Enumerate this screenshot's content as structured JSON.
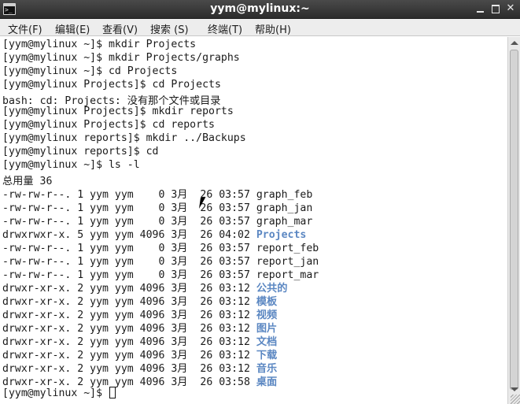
{
  "window": {
    "title": "yym@mylinux:~",
    "close_glyph": "✕"
  },
  "menu": [
    "文件(F)",
    "编辑(E)",
    "查看(V)",
    "搜索 (S)",
    "终端(T)",
    "帮助(H)"
  ],
  "terminal_lines": [
    {
      "text": "[yym@mylinux ~]$ mkdir Projects"
    },
    {
      "text": "[yym@mylinux ~]$ mkdir Projects/graphs"
    },
    {
      "text": "[yym@mylinux ~]$ cd Projects"
    },
    {
      "text": "[yym@mylinux Projects]$ cd Projects"
    },
    {
      "text": "bash: cd: Projects: 没有那个文件或目录"
    },
    {
      "text": "[yym@mylinux Projects]$ mkdir reports"
    },
    {
      "text": "[yym@mylinux Projects]$ cd reports"
    },
    {
      "text": "[yym@mylinux reports]$ mkdir ../Backups"
    },
    {
      "text": "[yym@mylinux reports]$ cd"
    },
    {
      "text": "[yym@mylinux ~]$ ls -l"
    },
    {
      "text": "总用量 36"
    },
    {
      "prefix": "-rw-rw-r--. 1 yym yym    0 3月  26 03:57 ",
      "name": "graph_feb",
      "dir": false
    },
    {
      "prefix": "-rw-rw-r--. 1 yym yym    0 3月  26 03:57 ",
      "name": "graph_jan",
      "dir": false
    },
    {
      "prefix": "-rw-rw-r--. 1 yym yym    0 3月  26 03:57 ",
      "name": "graph_mar",
      "dir": false
    },
    {
      "prefix": "drwxrwxr-x. 5 yym yym 4096 3月  26 04:02 ",
      "name": "Projects",
      "dir": true
    },
    {
      "prefix": "-rw-rw-r--. 1 yym yym    0 3月  26 03:57 ",
      "name": "report_feb",
      "dir": false
    },
    {
      "prefix": "-rw-rw-r--. 1 yym yym    0 3月  26 03:57 ",
      "name": "report_jan",
      "dir": false
    },
    {
      "prefix": "-rw-rw-r--. 1 yym yym    0 3月  26 03:57 ",
      "name": "report_mar",
      "dir": false
    },
    {
      "prefix": "drwxr-xr-x. 2 yym yym 4096 3月  26 03:12 ",
      "name": "公共的",
      "dir": true
    },
    {
      "prefix": "drwxr-xr-x. 2 yym yym 4096 3月  26 03:12 ",
      "name": "模板",
      "dir": true
    },
    {
      "prefix": "drwxr-xr-x. 2 yym yym 4096 3月  26 03:12 ",
      "name": "视频",
      "dir": true
    },
    {
      "prefix": "drwxr-xr-x. 2 yym yym 4096 3月  26 03:12 ",
      "name": "图片",
      "dir": true
    },
    {
      "prefix": "drwxr-xr-x. 2 yym yym 4096 3月  26 03:12 ",
      "name": "文档",
      "dir": true
    },
    {
      "prefix": "drwxr-xr-x. 2 yym yym 4096 3月  26 03:12 ",
      "name": "下载",
      "dir": true
    },
    {
      "prefix": "drwxr-xr-x. 2 yym yym 4096 3月  26 03:12 ",
      "name": "音乐",
      "dir": true
    },
    {
      "prefix": "drwxr-xr-x. 2 yym yym 4096 3月  26 03:58 ",
      "name": "桌面",
      "dir": true
    },
    {
      "text": "[yym@mylinux ~]$ ",
      "cursor": true
    }
  ],
  "colors": {
    "directory": "#5b87c2",
    "text": "#1a1a1a",
    "background": "#ffffff",
    "titlebar": "#2c2c2c"
  }
}
